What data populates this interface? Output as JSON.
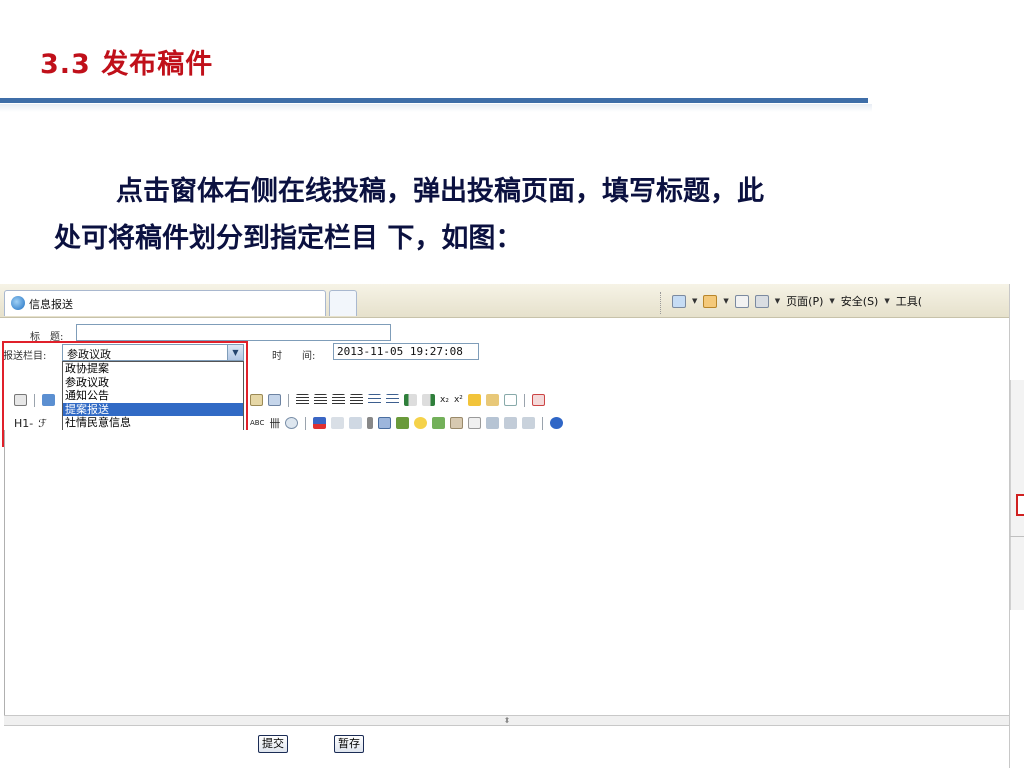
{
  "slide": {
    "title": "3.3 发布稿件",
    "description_line1": "点击窗体右侧在线投稿，弹出投稿页面，填写标题，此",
    "description_line2": "处可将稿件划分到指定栏目 下，如图："
  },
  "browser": {
    "tab_title": "信息报送",
    "menu_page": "页面(P)",
    "menu_safety": "安全(S)",
    "menu_tools": "工具("
  },
  "form": {
    "title_label": "标　题:",
    "title_value": "",
    "column_label": "报送栏目:",
    "column_selected": "参政议政",
    "time_label": "时　　间:",
    "time_value": "2013-11-05 19:27:08",
    "column_options": [
      "政协提案",
      "参政议政",
      "通知公告",
      "提案报送",
      "社情民意信息"
    ],
    "highlighted_option": "提案报送"
  },
  "editor": {
    "heading_menu": "H1-",
    "font_glyph": "ℱ",
    "abc_label": "ABC",
    "grid_glyph": "卌"
  },
  "buttons": {
    "submit": "提交",
    "save_draft": "暂存"
  },
  "colors": {
    "title_red": "#c0101a",
    "rule_blue": "#3f6ea8",
    "body_navy": "#0b1140",
    "highlight_red": "#e0202a",
    "selection_blue": "#316ac5"
  }
}
